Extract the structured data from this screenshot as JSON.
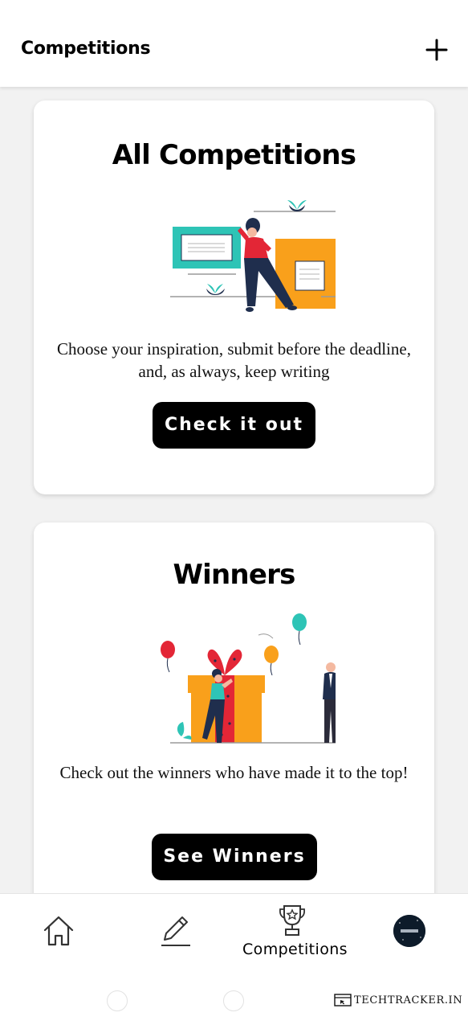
{
  "header": {
    "title": "Competitions",
    "add_icon": "plus-icon"
  },
  "cards": [
    {
      "title": "All Competitions",
      "illustration": "woman-with-boards-illustration",
      "description": "Choose your inspiration, submit before the deadline, and, as always, keep writing",
      "button_label": "Check it out"
    },
    {
      "title": "Winners",
      "illustration": "gift-box-celebration-illustration",
      "description": "Check out the winners who have made it to the top!",
      "button_label": "See Winners"
    }
  ],
  "bottom_nav": {
    "items": [
      {
        "icon": "home-icon"
      },
      {
        "icon": "pencil-icon"
      },
      {
        "icon": "trophy-icon",
        "label": "Competitions"
      },
      {
        "icon": "profile-avatar"
      }
    ]
  },
  "watermark": "TECHTRACKER.IN",
  "colors": {
    "teal": "#2ec4b6",
    "orange": "#f9a01b",
    "red": "#e32636",
    "navy": "#1f2e4d",
    "button_bg": "#000000",
    "card_bg": "#ffffff",
    "page_bg": "#f2f2f2"
  }
}
